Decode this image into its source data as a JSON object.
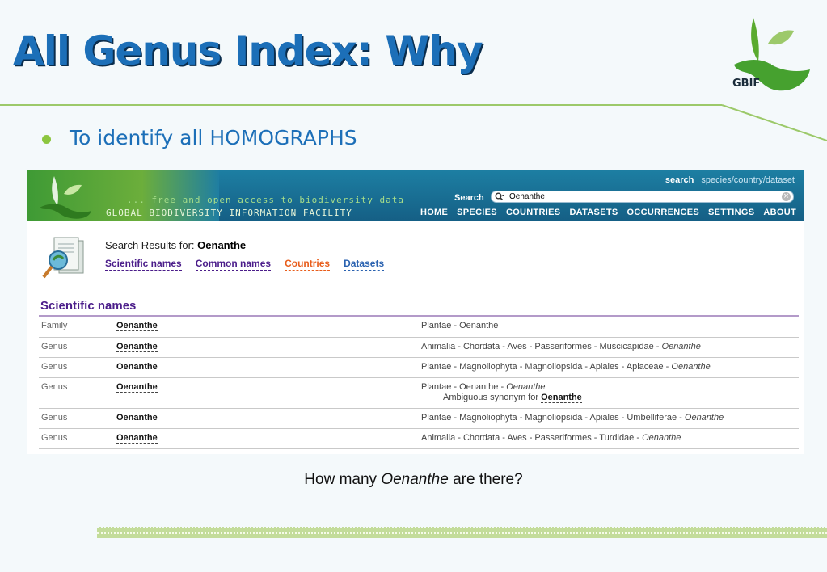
{
  "slide": {
    "title": "All Genus Index:  Why",
    "bullet": "To identify all HOMOGRAPHS",
    "logo_text": "GBIF",
    "caption": {
      "before": "How many ",
      "italic": "Oenanthe",
      "after": " are there?"
    }
  },
  "colors": {
    "title": "#1c6fb8",
    "accent_green": "#8cc63f",
    "header_blue": "#1a7199"
  },
  "screenshot": {
    "tagline": "... free and open access to biodiversity data",
    "org_name": "GLOBAL BIODIVERSITY INFORMATION FACILITY",
    "top_links": {
      "search": "search",
      "scope": "species/country/dataset"
    },
    "search": {
      "label": "Search",
      "value": "Oenanthe"
    },
    "nav": [
      "HOME",
      "SPECIES",
      "COUNTRIES",
      "DATASETS",
      "OCCURRENCES",
      "SETTINGS",
      "ABOUT"
    ],
    "results_prefix": "Search Results for: ",
    "results_query": "Oenanthe",
    "tabs": [
      "Scientific names",
      "Common names",
      "Countries",
      "Datasets"
    ],
    "section_title": "Scientific names",
    "rows": [
      {
        "rank": "Family",
        "name": "Oenanthe",
        "path": "Plantae - Oenanthe",
        "path_italic": ""
      },
      {
        "rank": "Genus",
        "name": "Oenanthe",
        "path": "Animalia - Chordata - Aves - Passeriformes - Muscicapidae - ",
        "path_italic": "Oenanthe"
      },
      {
        "rank": "Genus",
        "name": "Oenanthe",
        "path": "Plantae - Magnoliophyta - Magnoliopsida - Apiales - Apiaceae - ",
        "path_italic": "Oenanthe"
      },
      {
        "rank": "Genus",
        "name": "Oenanthe",
        "path": "Plantae - Oenanthe - ",
        "path_italic": "Oenanthe",
        "synonym_label": "Ambiguous synonym for ",
        "synonym_name": "Oenanthe"
      },
      {
        "rank": "Genus",
        "name": "Oenanthe",
        "path": "Plantae - Magnoliophyta - Magnoliopsida - Apiales - Umbelliferae - ",
        "path_italic": "Oenanthe"
      },
      {
        "rank": "Genus",
        "name": "Oenanthe",
        "path": "Animalia - Chordata - Aves - Passeriformes - Turdidae - ",
        "path_italic": "Oenanthe"
      }
    ]
  }
}
